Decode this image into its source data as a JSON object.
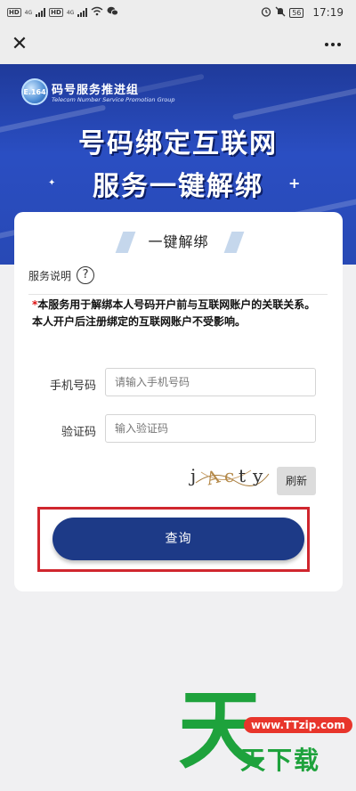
{
  "status_bar": {
    "network_left": "4G",
    "network_right": "4G",
    "battery": "56",
    "time": "17:19"
  },
  "top_bar": {
    "close_icon": "close-icon",
    "more_icon": "more-dots-icon"
  },
  "banner": {
    "logo_text": "E.164",
    "org_name": "码号服务推进组",
    "org_subtitle": "Telecom Number Service Promotion Group",
    "headline_line1": "号码绑定互联网",
    "headline_line2": "服务一键解绑",
    "colors": {
      "primary": "#2a4ec2",
      "dark": "#1f3a9a"
    }
  },
  "card": {
    "title": "一键解绑",
    "service_label": "服务说明",
    "help_glyph": "?",
    "notice_star": "*",
    "notice_text": "本服务用于解绑本人号码开户前与互联网账户的关联关系。本人开户后注册绑定的互联网账户不受影响。",
    "phone": {
      "label": "手机号码",
      "placeholder": "请输入手机号码",
      "value": ""
    },
    "code": {
      "label": "验证码",
      "placeholder": "输入验证码",
      "value": ""
    },
    "captcha_chars": [
      "j",
      "A",
      "c",
      "t",
      "y"
    ],
    "refresh_label": "刷新",
    "query_label": "查询",
    "colors": {
      "button": "#1d3a87",
      "highlight": "#d0262e",
      "star": "#dd1111"
    }
  },
  "watermark": {
    "big_char": "天",
    "url": "www.TTzip.com",
    "sub_text": "天下载"
  }
}
